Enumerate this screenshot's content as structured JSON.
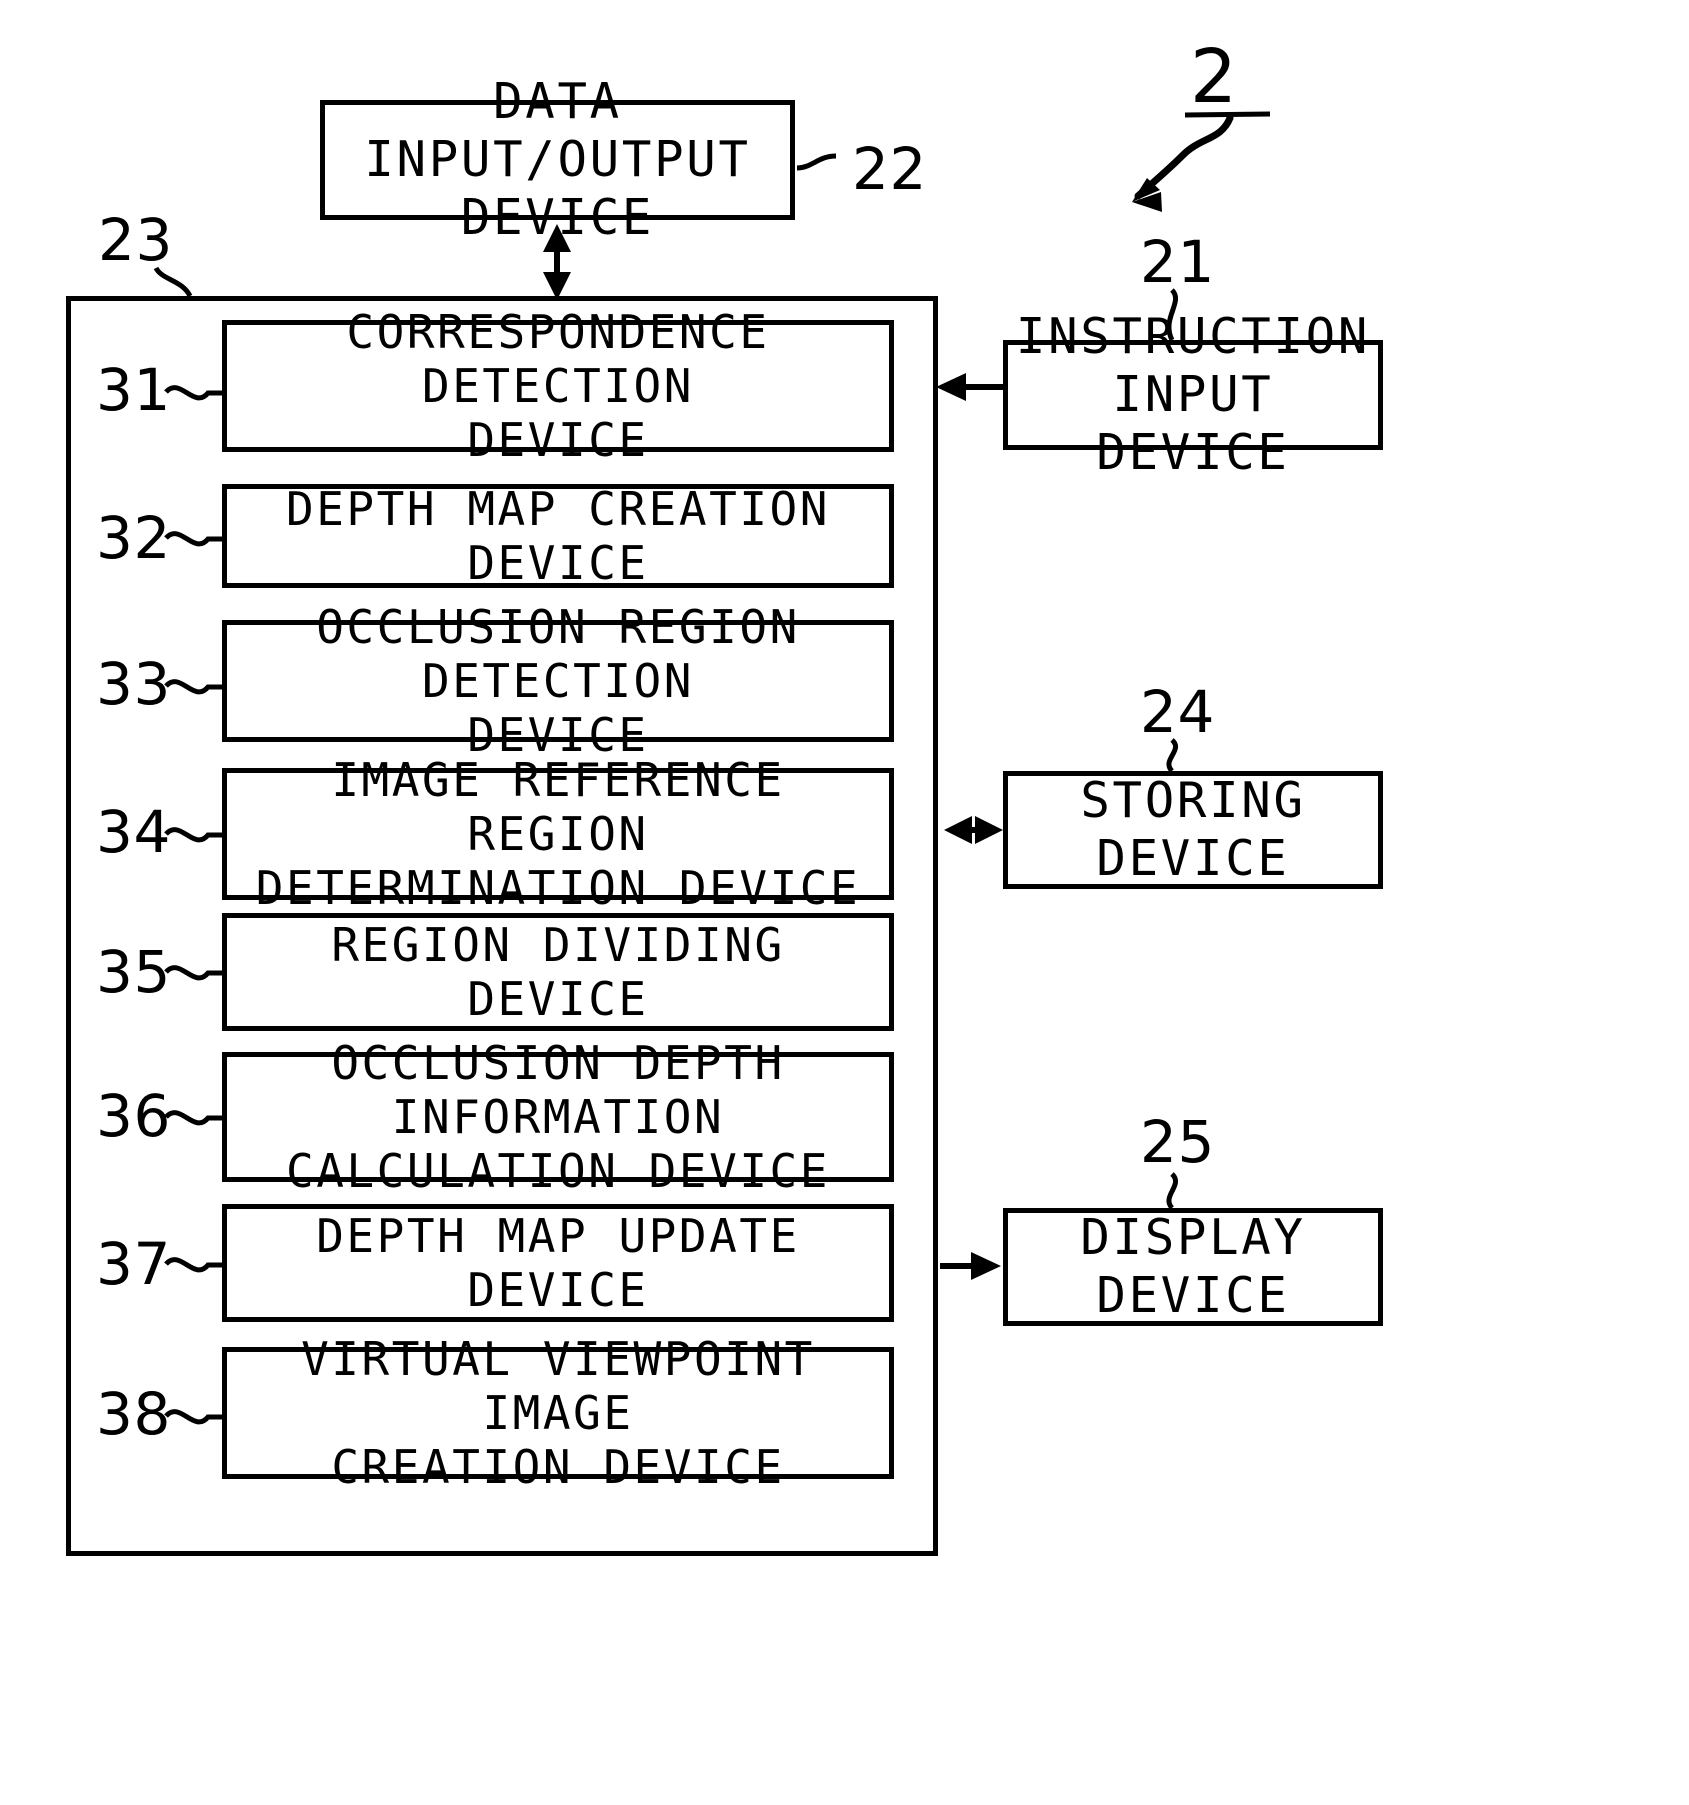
{
  "figure": {
    "main_reference": "2",
    "container": {
      "ref": "23",
      "blocks": [
        {
          "ref": "31",
          "label": "CORRESPONDENCE DETECTION\nDEVICE",
          "lines": 2
        },
        {
          "ref": "32",
          "label": "DEPTH MAP CREATION DEVICE",
          "lines": 1
        },
        {
          "ref": "33",
          "label": "OCCLUSION REGION DETECTION\nDEVICE",
          "lines": 2
        },
        {
          "ref": "34",
          "label": "IMAGE REFERENCE REGION\nDETERMINATION DEVICE",
          "lines": 2
        },
        {
          "ref": "35",
          "label": "REGION DIVIDING DEVICE",
          "lines": 1
        },
        {
          "ref": "36",
          "label": "OCCLUSION DEPTH INFORMATION\nCALCULATION DEVICE",
          "lines": 2
        },
        {
          "ref": "37",
          "label": "DEPTH MAP UPDATE DEVICE",
          "lines": 1
        },
        {
          "ref": "38",
          "label": "VIRTUAL VIEWPOINT IMAGE\nCREATION DEVICE",
          "lines": 2
        }
      ]
    },
    "external_blocks": [
      {
        "ref": "22",
        "label": "DATA INPUT/OUTPUT\nDEVICE",
        "position": "top"
      },
      {
        "ref": "21",
        "label": "INSTRUCTION\nINPUT DEVICE",
        "position": "right-top"
      },
      {
        "ref": "24",
        "label": "STORING DEVICE",
        "position": "right-middle"
      },
      {
        "ref": "25",
        "label": "DISPLAY DEVICE",
        "position": "right-bottom"
      }
    ],
    "connectors": [
      {
        "name": "data-io-to-container",
        "type": "bidirectional-vertical"
      },
      {
        "name": "instruction-input-to-container",
        "type": "unidirectional-left"
      },
      {
        "name": "container-to-storing",
        "type": "bidirectional-horizontal"
      },
      {
        "name": "container-to-display",
        "type": "unidirectional-right"
      },
      {
        "name": "main-reference-leader",
        "type": "curved-arrow"
      }
    ],
    "stroke_color": "#000000",
    "background_color": "#ffffff"
  }
}
